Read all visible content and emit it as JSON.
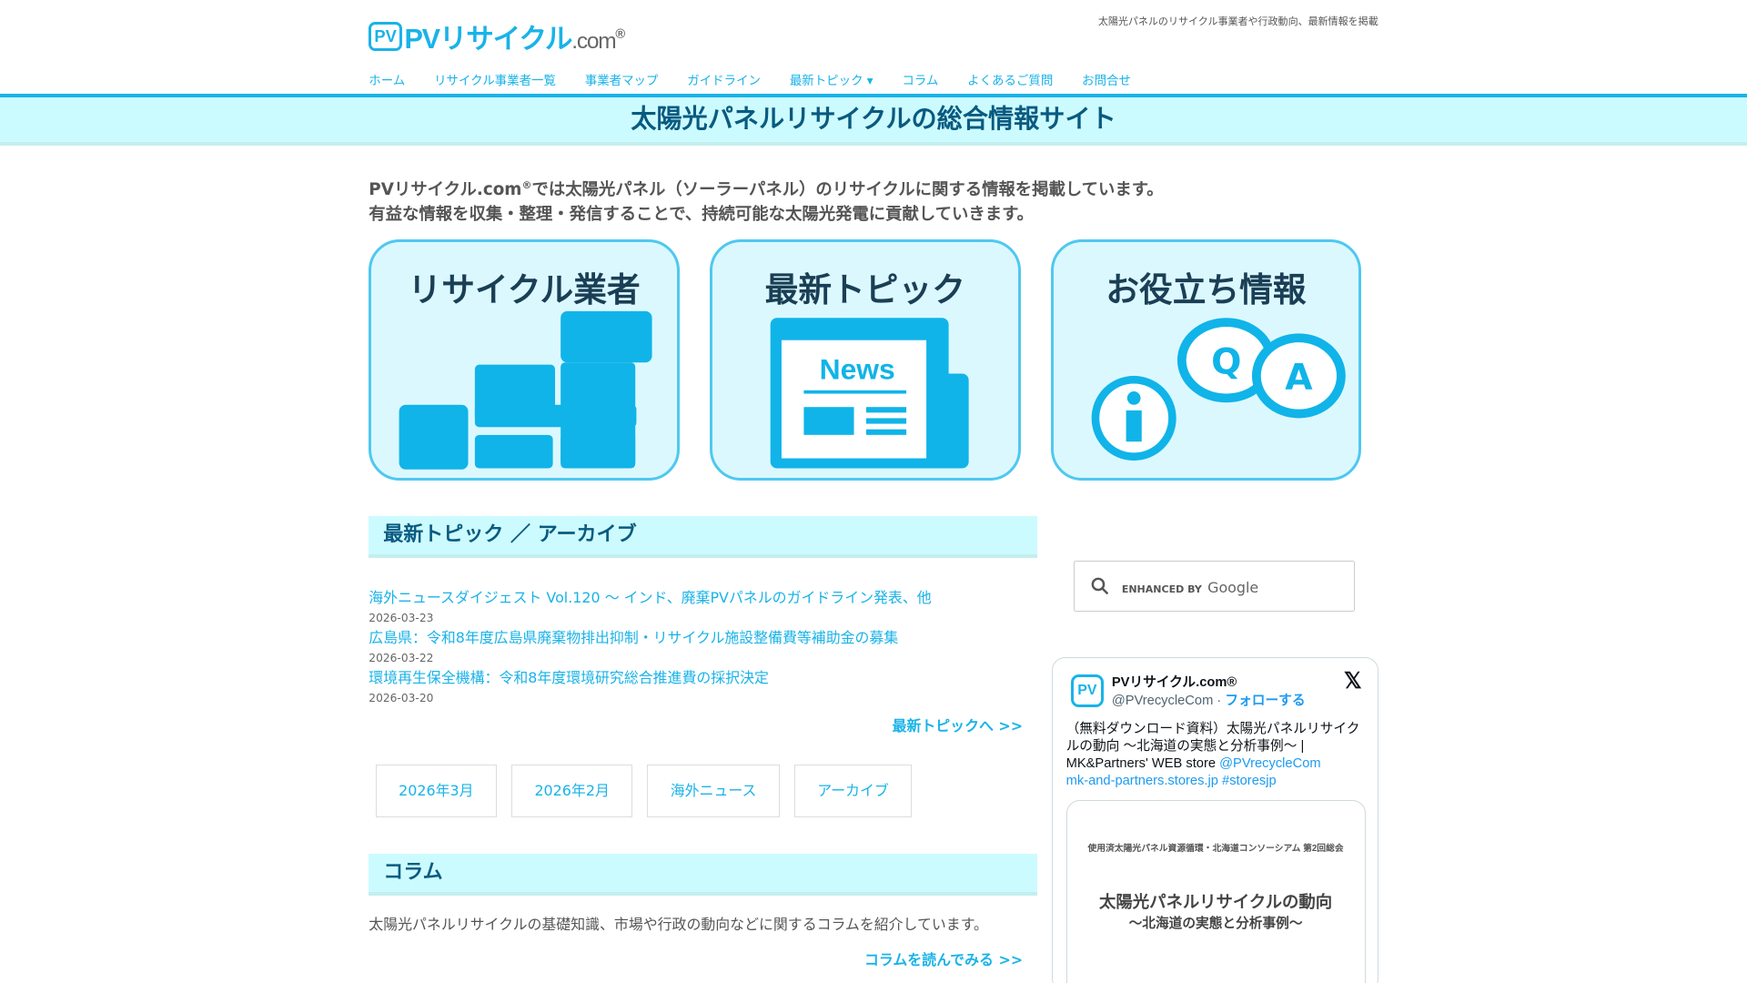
{
  "header": {
    "logo_mark": "PV",
    "logo_name": "PVリサイクル",
    "logo_suffix": ".com",
    "logo_reg": "®",
    "tagline": "太陽光パネルのリサイクル事業者や行政動向、最新情報を掲載"
  },
  "nav": [
    {
      "label": "ホーム"
    },
    {
      "label": "リサイクル事業者一覧"
    },
    {
      "label": "事業者マップ"
    },
    {
      "label": "ガイドライン"
    },
    {
      "label": "最新トピック ▾"
    },
    {
      "label": "コラム"
    },
    {
      "label": "よくあるご質問"
    },
    {
      "label": "お問合せ"
    }
  ],
  "hero": {
    "title": "太陽光パネルリサイクルの総合情報サイト"
  },
  "intro": {
    "brand": "PVリサイクル.com",
    "reg": "®",
    "line1": "では太陽光パネル（ソーラーパネル）のリサイクルに関する情報を掲載しています。",
    "line2": "有益な情報を収集・整理・発信することで、持続可能な太陽光発電に貢献していきます。"
  },
  "cards": [
    {
      "title": "リサイクル業者"
    },
    {
      "title": "最新トピック",
      "icon_text": "News"
    },
    {
      "title": "お役立ち情報",
      "q": "Q",
      "a": "A"
    }
  ],
  "topics": {
    "heading": "最新トピック ／ アーカイブ",
    "items": [
      {
        "title": "海外ニュースダイジェスト Vol.120 ～ インド、廃棄PVパネルのガイドライン発表、他",
        "date": "2026-03-23"
      },
      {
        "title": "広島県：令和8年度広島県廃棄物排出抑制・リサイクル施設整備費等補助金の募集",
        "date": "2026-03-22"
      },
      {
        "title": "環境再生保全機構：令和8年度環境研究総合推進費の採択決定",
        "date": "2026-03-20"
      }
    ],
    "more": "最新トピックへ >>",
    "tags": [
      "2026年3月",
      "2026年2月",
      "海外ニュース",
      "アーカイブ"
    ]
  },
  "column": {
    "heading": "コラム",
    "text": "太陽光パネルリサイクルの基礎知識、市場や行政の動向などに関するコラムを紹介しています。",
    "more": "コラムを読んでみる >>"
  },
  "search": {
    "enhanced": "ENHANCED BY",
    "google": "Google"
  },
  "tweet": {
    "avatar": "PV",
    "name": "PVリサイクル.com®",
    "handle": "@PVrecycleCom",
    "sep": " · ",
    "follow": "フォローする",
    "x": "𝕏",
    "text": "（無料ダウンロード資料）太陽光パネルリサイクルの動向 ～北海道の実態と分析事例～ | MK&Partners' WEB store ",
    "mention": "@PVrecycleCom",
    "link": "mk-and-partners.stores.jp",
    "hashtag": "#storesjp",
    "card_sub": "使用済太陽光パネル資源循環・北海道コンソーシアム 第2回総会",
    "card_title": "太陽光パネルリサイクルの動向",
    "card_subtitle": "～北海道の実態と分析事例～"
  }
}
